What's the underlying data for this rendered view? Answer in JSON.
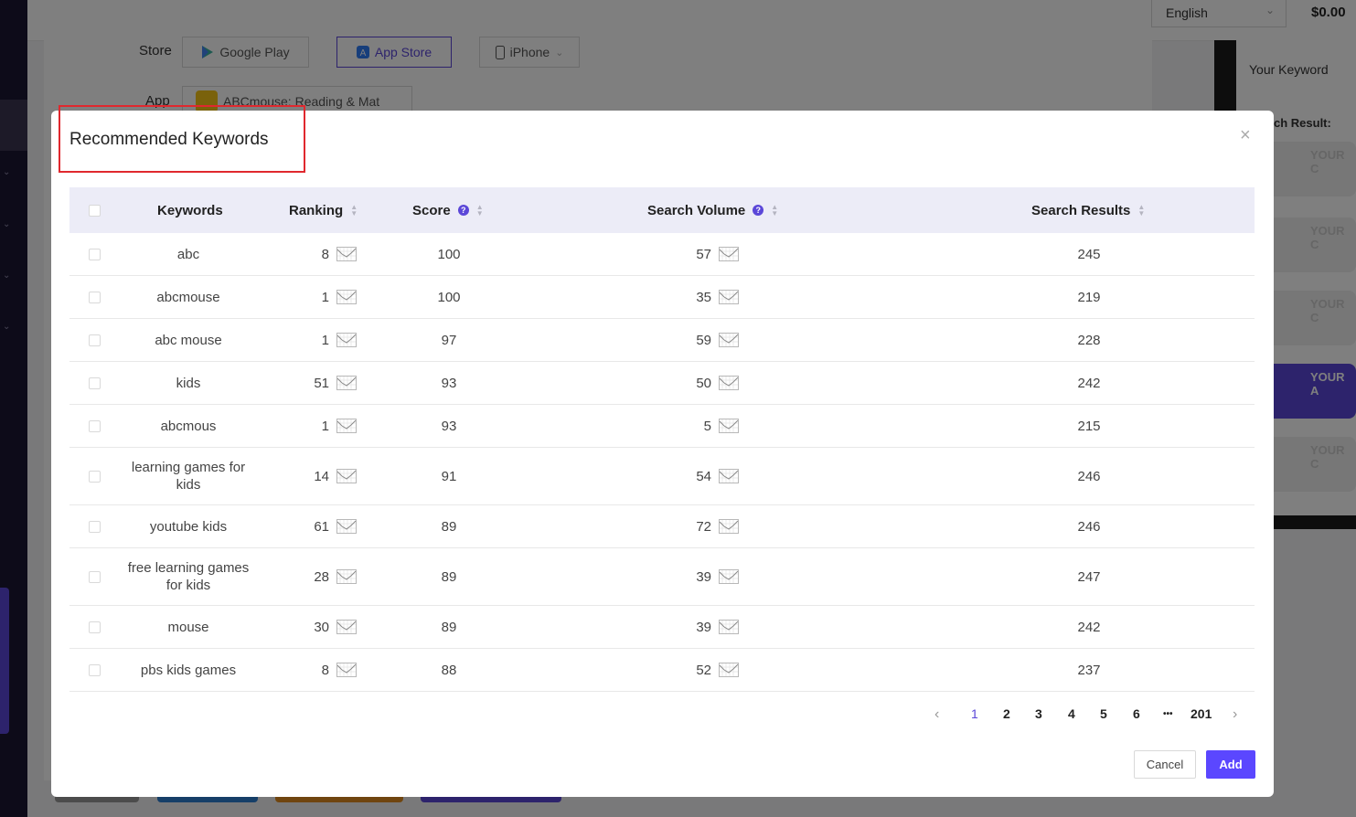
{
  "topbar": {
    "language": "English",
    "balance": "$0.00"
  },
  "background": {
    "store_label": "Store",
    "store_google": "Google Play",
    "store_apple": "App Store",
    "device": "iPhone",
    "app_label": "App",
    "app_name": "ABCmouse: Reading & Mat",
    "phone_keyword": "Your Keyword",
    "phone_result_label": "ch Result:",
    "phone_card_text": "YOUR C",
    "phone_card_text_active": "YOUR A"
  },
  "modal": {
    "title": "Recommended Keywords",
    "close": "×",
    "columns": {
      "keywords": "Keywords",
      "ranking": "Ranking",
      "score": "Score",
      "search_volume": "Search Volume",
      "search_results": "Search Results"
    },
    "help_glyph": "?",
    "rows": [
      {
        "keyword": "abc",
        "ranking": "8",
        "score": "100",
        "volume": "57",
        "results": "245"
      },
      {
        "keyword": "abcmouse",
        "ranking": "1",
        "score": "100",
        "volume": "35",
        "results": "219"
      },
      {
        "keyword": "abc mouse",
        "ranking": "1",
        "score": "97",
        "volume": "59",
        "results": "228"
      },
      {
        "keyword": "kids",
        "ranking": "51",
        "score": "93",
        "volume": "50",
        "results": "242"
      },
      {
        "keyword": "abcmous",
        "ranking": "1",
        "score": "93",
        "volume": "5",
        "results": "215"
      },
      {
        "keyword": "learning games for kids",
        "ranking": "14",
        "score": "91",
        "volume": "54",
        "results": "246"
      },
      {
        "keyword": "youtube kids",
        "ranking": "61",
        "score": "89",
        "volume": "72",
        "results": "246"
      },
      {
        "keyword": "free learning games for kids",
        "ranking": "28",
        "score": "89",
        "volume": "39",
        "results": "247"
      },
      {
        "keyword": "mouse",
        "ranking": "30",
        "score": "89",
        "volume": "39",
        "results": "242"
      },
      {
        "keyword": "pbs kids games",
        "ranking": "8",
        "score": "88",
        "volume": "52",
        "results": "237"
      }
    ],
    "pagination": {
      "prev": "‹",
      "pages": [
        "1",
        "2",
        "3",
        "4",
        "5",
        "6"
      ],
      "ellipsis": "•••",
      "last": "201",
      "next": "›",
      "current": "1"
    },
    "cancel_label": "Cancel",
    "add_label": "Add"
  },
  "colors": {
    "accent": "#5b47ff",
    "highlight": "#e0282e",
    "header_bg": "#ececf7"
  }
}
